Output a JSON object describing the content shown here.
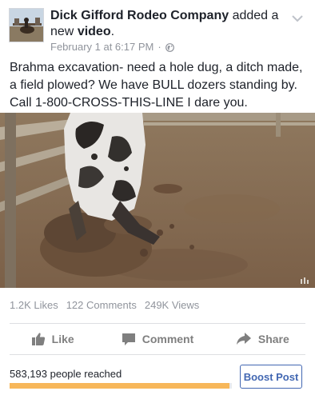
{
  "post": {
    "page_name": "Dick Gifford Rodeo Company",
    "action_prefix": "added a new",
    "action_object": "video",
    "action_suffix": ".",
    "timestamp": "February 1 at 6:17 PM",
    "privacy_icon": "globe-icon",
    "text": "Brahma excavation- need a hole dug, a ditch made, a field plowed? We have BULL dozers standing by. Call 1-800-CROSS-THIS-LINE I dare you."
  },
  "video": {
    "subject": "bull digging dirt in a rodeo pen"
  },
  "stats": {
    "likes": "1.2K Likes",
    "comments": "122 Comments",
    "views": "249K Views"
  },
  "actions": {
    "like_label": "Like",
    "comment_label": "Comment",
    "share_label": "Share"
  },
  "reach": {
    "text": "583,193 people reached",
    "bar_fill_fraction": 0.99,
    "bar_color": "#f7b75a"
  },
  "boost": {
    "label": "Boost Post",
    "color": "#4267b2"
  }
}
